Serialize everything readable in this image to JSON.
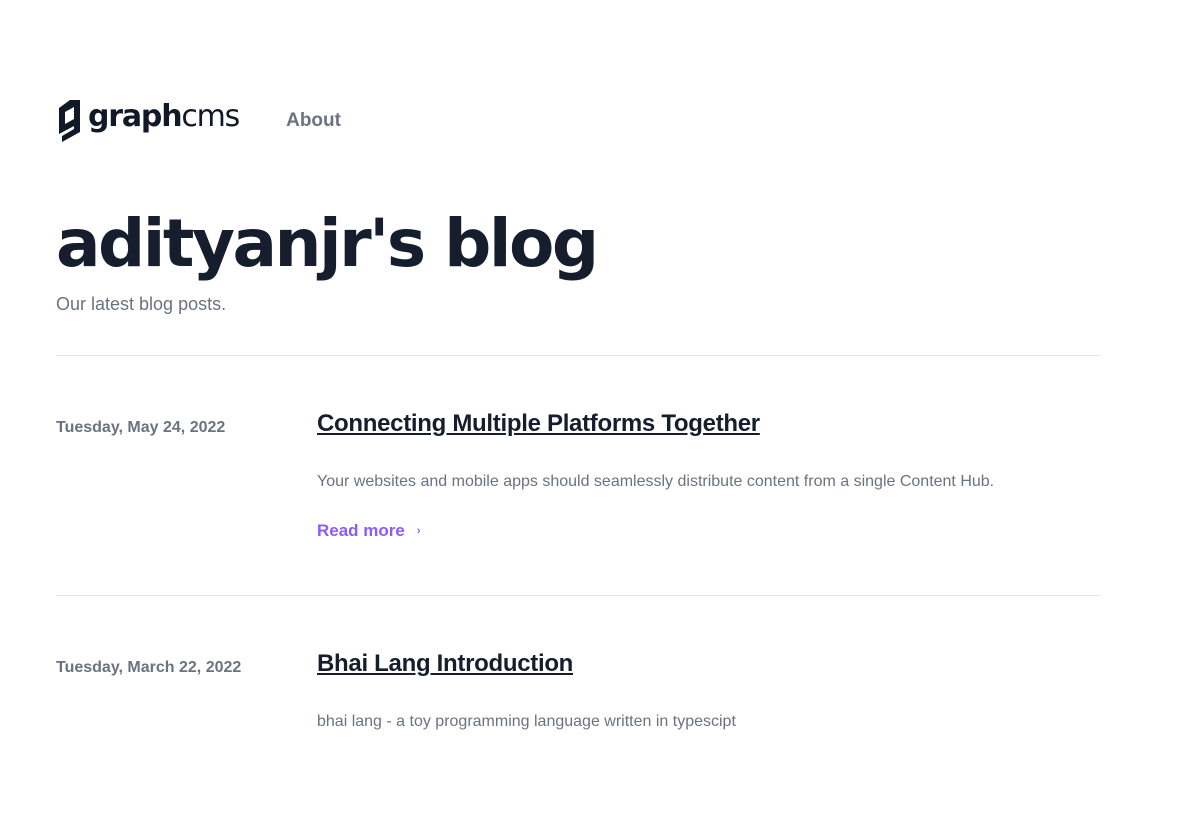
{
  "header": {
    "logo_text_bold": "graph",
    "logo_text_light": "cms",
    "nav": [
      {
        "label": "About"
      }
    ]
  },
  "hero": {
    "title": "adityanjr's blog",
    "subtitle": "Our latest blog posts."
  },
  "posts": [
    {
      "date": "Tuesday, May 24, 2022",
      "title": "Connecting Multiple Platforms Together",
      "excerpt": "Your websites and mobile apps should seamlessly distribute content from a single Content Hub.",
      "read_more": "Read more",
      "read_more_icon": "chevron-right-icon"
    },
    {
      "date": "Tuesday, March 22, 2022",
      "title": "Bhai Lang Introduction",
      "excerpt": "bhai lang - a toy programming language written in typescipt"
    }
  ],
  "colors": {
    "accent": "#8b5cf6",
    "heading": "#161e2e",
    "muted": "#6b7280",
    "divider": "#e5e7eb"
  }
}
